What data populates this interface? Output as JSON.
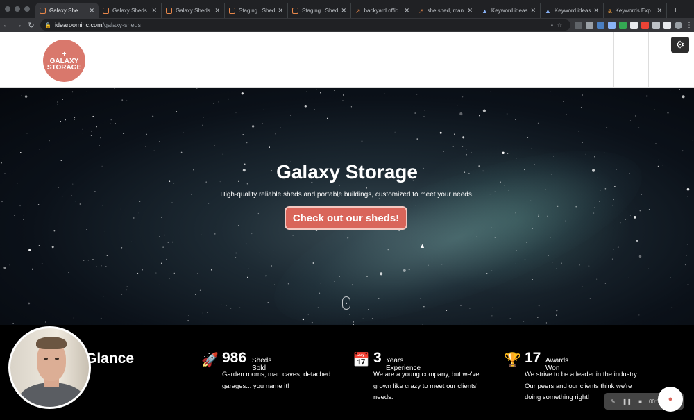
{
  "browser": {
    "tabs": [
      {
        "label": "Galaxy She",
        "icon": "idearoom-icon",
        "active": true
      },
      {
        "label": "Galaxy Sheds",
        "icon": "idearoom-icon"
      },
      {
        "label": "Galaxy Sheds",
        "icon": "idearoom-icon"
      },
      {
        "label": "Staging | Shed",
        "icon": "idearoom-icon"
      },
      {
        "label": "Staging | Shed",
        "icon": "idearoom-icon"
      },
      {
        "label": "backyard offic",
        "icon": "keyword-icon"
      },
      {
        "label": "she shed, man",
        "icon": "keyword-icon"
      },
      {
        "label": "Keyword ideas",
        "icon": "ads-icon"
      },
      {
        "label": "Keyword ideas",
        "icon": "ads-icon"
      },
      {
        "label": "Keywords Exp",
        "icon": "ahrefs-icon"
      }
    ],
    "url_host": "idearoominc.com",
    "url_path": "/galaxy-sheds"
  },
  "site": {
    "logo_top": "GALAXY",
    "logo_bottom": "STORAGE",
    "hero_title": "Galaxy Storage",
    "hero_subtitle": "High-quality reliable sheds and portable buildings, customized to meet your needs.",
    "cta_label": "Check out our sheds!",
    "glance_title": "Glance",
    "stats": [
      {
        "icon": "rocket-icon",
        "number": "986",
        "unit": "Sheds Sold",
        "desc": "Garden rooms, man caves, detached garages... you name it!"
      },
      {
        "icon": "calendar-check-icon",
        "number": "3",
        "unit": "Years Experience",
        "desc": "We are a young company, but we've grown like crazy to meet our clients' needs."
      },
      {
        "icon": "trophy-icon",
        "number": "17",
        "unit": "Awards Won",
        "desc": "We strive to be a leader in the industry. Our peers and our clients think we're doing something right!"
      }
    ]
  },
  "recorder": {
    "time": "00:16"
  },
  "colors": {
    "accent": "#d9655a",
    "logo": "#d9786c"
  }
}
